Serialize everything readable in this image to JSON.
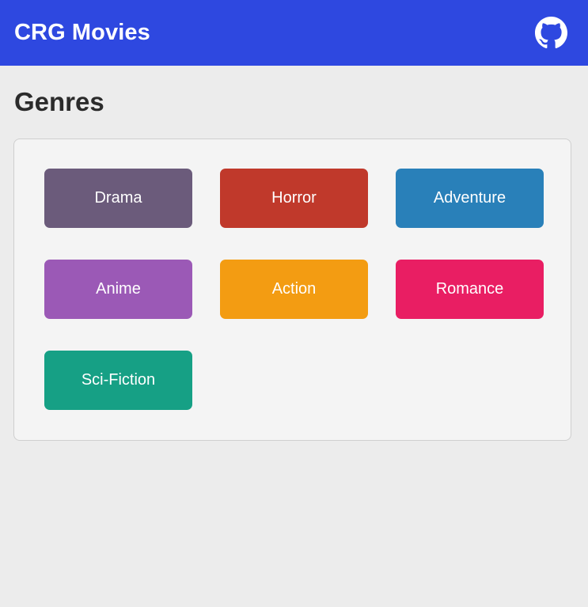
{
  "header": {
    "title": "CRG Movies",
    "github_icon": "github-icon",
    "background_color": "#2e48e0"
  },
  "main": {
    "heading": "Genres",
    "genres": [
      {
        "label": "Drama",
        "color": "#6b5b7b"
      },
      {
        "label": "Horror",
        "color": "#c0392b"
      },
      {
        "label": "Adventure",
        "color": "#2980b9"
      },
      {
        "label": "Anime",
        "color": "#9b59b6"
      },
      {
        "label": "Action",
        "color": "#f39c12"
      },
      {
        "label": "Romance",
        "color": "#e91e63"
      },
      {
        "label": "Sci-Fiction",
        "color": "#16a085"
      }
    ]
  }
}
